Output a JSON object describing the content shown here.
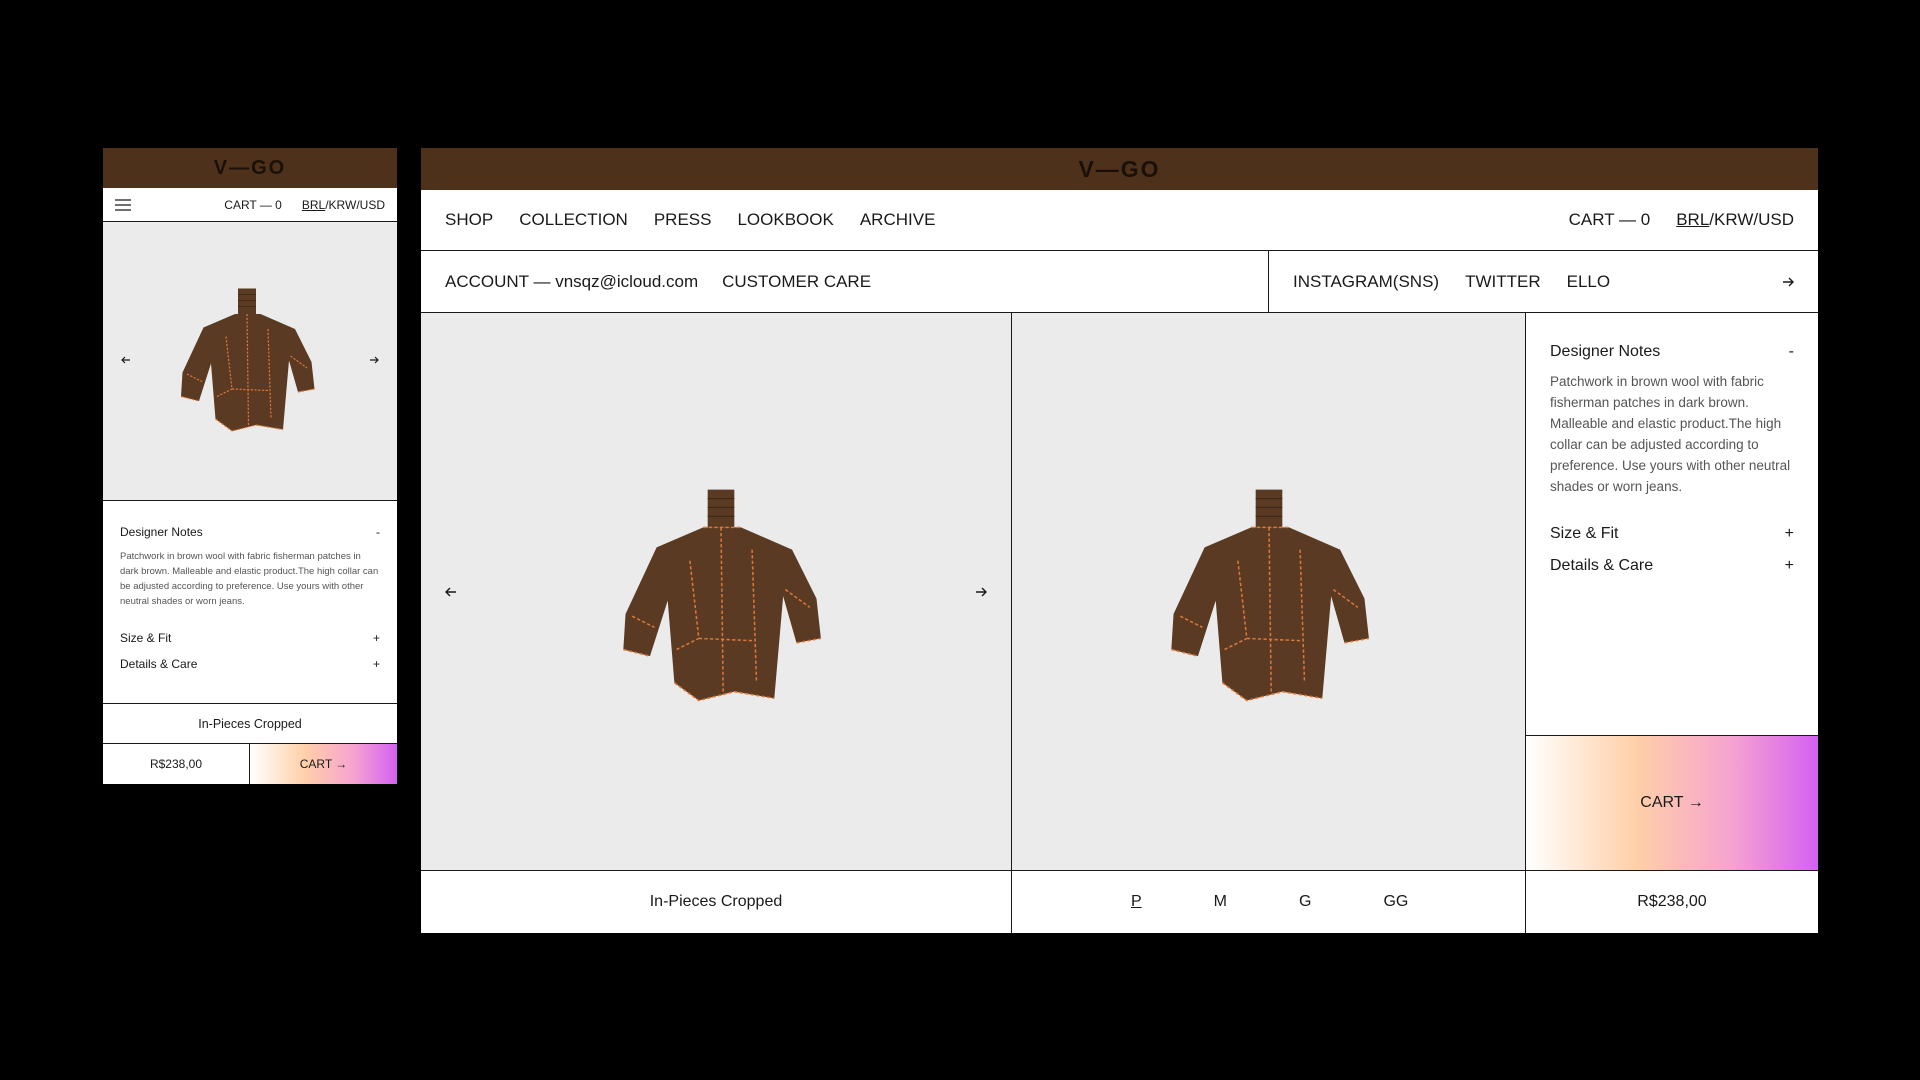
{
  "brand": "V—GO",
  "nav": {
    "links": [
      "SHOP",
      "COLLECTION",
      "PRESS",
      "LOOKBOOK",
      "ARCHIVE"
    ],
    "cart": "CART — 0",
    "currency_active": "BRL",
    "currency_rest": "/KRW/USD"
  },
  "subnav": {
    "account": "ACCOUNT — vnsqz@icloud.com",
    "care": "CUSTOMER CARE",
    "social": [
      "INSTAGRAM(SNS)",
      "TWITTER",
      "ELLO"
    ]
  },
  "product": {
    "name": "In-Pieces Cropped",
    "price": "R$238,00",
    "sizes": [
      "P",
      "M",
      "G",
      "GG"
    ],
    "selected_size": "P",
    "cart_button": "CART →",
    "image": "brown-patchwork-turtleneck-sweater"
  },
  "accordion": {
    "notes_title": "Designer Notes",
    "notes_toggle": "-",
    "notes_body": "Patchwork in brown wool with fabric fisherman patches in dark brown. Malleable and elastic product.The high collar can be adjusted according to preference. Use yours with other neutral shades or worn jeans.",
    "size_title": "Size & Fit",
    "details_title": "Details & Care",
    "expand_toggle": "+"
  },
  "icons": {
    "prev": "arrow-left-icon",
    "next": "arrow-right-icon",
    "menu": "hamburger-menu-icon",
    "social_next": "arrow-right-icon"
  },
  "colors": {
    "brand_bar": "#4e311b",
    "image_bg": "#ebebeb",
    "sweater": "#5a3a22",
    "stitch": "#d9773a",
    "gradient_end": "#d461f2"
  }
}
